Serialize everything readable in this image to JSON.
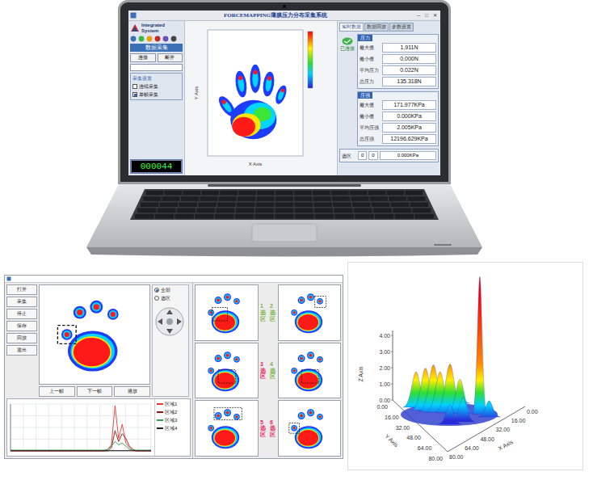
{
  "laptop_app": {
    "title": "FORCEMAPPING薄膜压力分布采集系统",
    "window_buttons": [
      "─",
      "□",
      "✕"
    ],
    "logo_text": "Integrated System",
    "left_panel": {
      "header": "数据采集",
      "buttons": [
        "连接",
        "断开"
      ],
      "group_title": "采集设置",
      "options": [
        {
          "label": "连续采集",
          "checked": false
        },
        {
          "label": "单帧采集",
          "checked": true
        }
      ],
      "counter": "000044"
    },
    "plot": {
      "x_label": "X Axis",
      "y_label": "Y Axis"
    },
    "tabs": [
      {
        "label": "实时数据",
        "selected": true
      },
      {
        "label": "数据回放",
        "selected": false
      },
      {
        "label": "参数设置",
        "selected": false
      }
    ],
    "status": "已连接",
    "force_group": {
      "title": "压力",
      "rows": [
        {
          "label": "最大值",
          "value": "1.911N"
        },
        {
          "label": "最小值",
          "value": "0.000N"
        },
        {
          "label": "平均压力",
          "value": "0.022N"
        },
        {
          "label": "总压力",
          "value": "135.318N"
        }
      ]
    },
    "pressure_group": {
      "title": "压强",
      "rows": [
        {
          "label": "最大值",
          "value": "171.977KPa"
        },
        {
          "label": "最小值",
          "value": "0.000KPa"
        },
        {
          "label": "平均压强",
          "value": "2.005KPa"
        },
        {
          "label": "总压强",
          "value": "12196.629KPa"
        }
      ]
    },
    "bottom_row": {
      "label": "选区",
      "fields": [
        "0",
        "0",
        "0.000KPa"
      ]
    }
  },
  "paw_app": {
    "tools": [
      "打开",
      "采集",
      "停止",
      "保存",
      "回放",
      "退出"
    ],
    "player_buttons": [
      "上一帧",
      "下一帧",
      "播放"
    ],
    "modes": [
      {
        "label": "全部",
        "selected": true
      },
      {
        "label": "选区",
        "selected": false
      }
    ],
    "main_highlight": "toe-left",
    "panels": [
      {
        "label": "1选区",
        "color": "#7cb342",
        "highlight": "palm-left"
      },
      {
        "label": "2选区",
        "color": "#7cb342",
        "highlight": "toe-right"
      },
      {
        "label": "3选区",
        "color": "#e91e63",
        "highlight": "palm-center"
      },
      {
        "label": "4选区",
        "color": "#7cb342",
        "highlight": "palm-center"
      },
      {
        "label": "5选区",
        "color": "#e91e63",
        "highlight": "toe-top"
      },
      {
        "label": "6选区",
        "color": "#e91e63",
        "highlight": "toe-left"
      }
    ],
    "chart": {
      "max": 3,
      "series": [
        {
          "name": "区域1",
          "color": "#e53935",
          "values": [
            0,
            0,
            0,
            0,
            0,
            0,
            0,
            0,
            0,
            0,
            0,
            0,
            0,
            0,
            0,
            0,
            0,
            0,
            0,
            0,
            0,
            0,
            0,
            0,
            0,
            0,
            0,
            0.1,
            0.4,
            2.9,
            0.8,
            1.7,
            0.5,
            0.2,
            0,
            0,
            0,
            0,
            0,
            0
          ]
        },
        {
          "name": "区域2",
          "color": "#8b1a1a",
          "values": [
            0,
            0,
            0,
            0,
            0,
            0,
            0,
            0,
            0,
            0,
            0,
            0,
            0,
            0,
            0,
            0,
            0,
            0,
            0,
            0,
            0,
            0,
            0,
            0,
            0,
            0,
            0,
            0,
            0.2,
            1.3,
            0.6,
            1.1,
            0.8,
            0.3,
            0.1,
            0,
            0,
            0,
            0,
            0
          ]
        },
        {
          "name": "区域3",
          "color": "#2e9e4f",
          "values": [
            0.05,
            0.05,
            0.05,
            0.05,
            0.05,
            0.05,
            0.05,
            0.05,
            0.05,
            0.05,
            0.05,
            0.05,
            0.05,
            0.05,
            0.05,
            0.05,
            0.05,
            0.05,
            0.05,
            0.05,
            0.05,
            0.05,
            0.05,
            0.05,
            0.05,
            0.05,
            0.05,
            0.1,
            0.3,
            0.6,
            0.4,
            0.5,
            0.3,
            0.1,
            0.05,
            0.05,
            0.05,
            0.05,
            0.05,
            0.05
          ]
        },
        {
          "name": "区域4",
          "color": "#222222",
          "values": [
            0.02,
            0.02,
            0.02,
            0.02,
            0.02,
            0.02,
            0.02,
            0.02,
            0.02,
            0.02,
            0.02,
            0.02,
            0.02,
            0.02,
            0.02,
            0.02,
            0.02,
            0.02,
            0.02,
            0.02,
            0.02,
            0.02,
            0.02,
            0.02,
            0.02,
            0.02,
            0.02,
            0.02,
            0.02,
            0.02,
            0.02,
            0.02,
            0.02,
            0.02,
            0.02,
            0.02,
            0.02,
            0.02,
            0.02,
            0.02
          ]
        }
      ]
    }
  },
  "surface_chart": {
    "z_label": "Z Axis",
    "y_label": "Y Axis",
    "x_label": "X Axis",
    "z_ticks": [
      "0.00",
      "1.00",
      "2.00",
      "3.00",
      "4.00"
    ],
    "y_ticks": [
      "0.00",
      "16.00",
      "32.00",
      "48.00",
      "64.00",
      "80.00"
    ],
    "x_ticks": [
      "0.00",
      "16.00",
      "32.00",
      "48.00",
      "64.00",
      "80.00"
    ],
    "peaks": [
      {
        "x": 70,
        "y": 20,
        "z": 2.2
      },
      {
        "x": 66,
        "y": 28,
        "z": 2.6
      },
      {
        "x": 62,
        "y": 34,
        "z": 2.9
      },
      {
        "x": 58,
        "y": 38,
        "z": 2.5
      },
      {
        "x": 52,
        "y": 44,
        "z": 3.0
      },
      {
        "x": 46,
        "y": 50,
        "z": 2.1
      },
      {
        "x": 34,
        "y": 62,
        "z": 8.5
      },
      {
        "x": 60,
        "y": 55,
        "z": 1.2
      },
      {
        "x": 40,
        "y": 40,
        "z": 0.8
      },
      {
        "x": 30,
        "y": 70,
        "z": 1.0
      },
      {
        "x": 50,
        "y": 60,
        "z": 1.5
      }
    ]
  }
}
